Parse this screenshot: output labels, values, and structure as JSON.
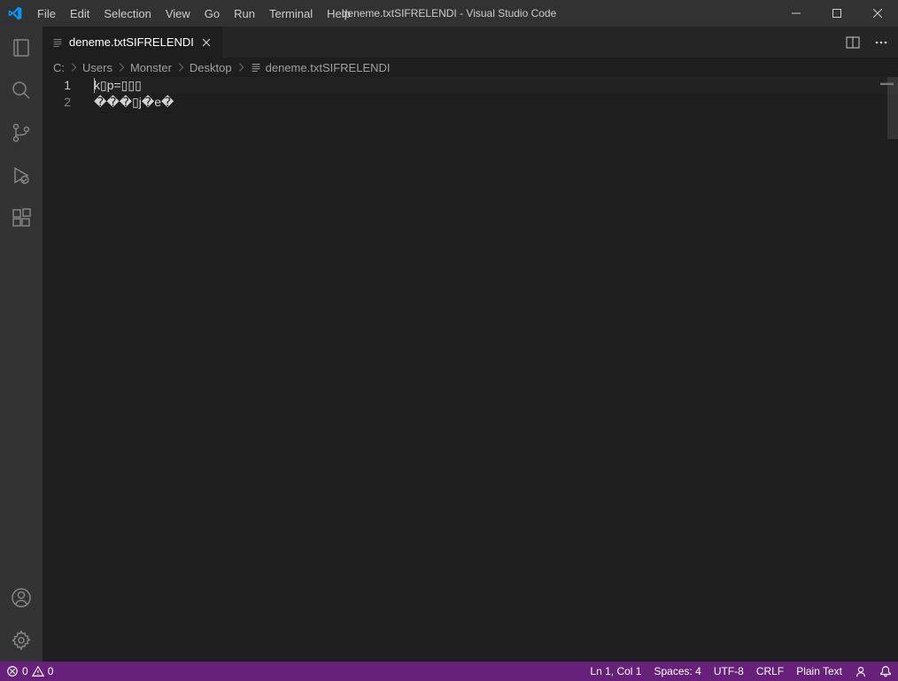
{
  "window": {
    "title": "deneme.txtSIFRELENDI - Visual Studio Code"
  },
  "menu": [
    "File",
    "Edit",
    "Selection",
    "View",
    "Go",
    "Run",
    "Terminal",
    "Help"
  ],
  "tab": {
    "label": "deneme.txtSIFRELENDI"
  },
  "breadcrumbs": [
    "C:",
    "Users",
    "Monster",
    "Desktop"
  ],
  "breadcrumb_file": "deneme.txtSIFRELENDI",
  "editor": {
    "lines": [
      {
        "num": "1",
        "text": "k▯p=▯▯▯"
      },
      {
        "num": "2",
        "text": "���▯j�e�"
      }
    ]
  },
  "status": {
    "errors": "0",
    "warnings": "0",
    "position": "Ln 1, Col 1",
    "spaces": "Spaces: 4",
    "encoding": "UTF-8",
    "eol": "CRLF",
    "language": "Plain Text"
  }
}
